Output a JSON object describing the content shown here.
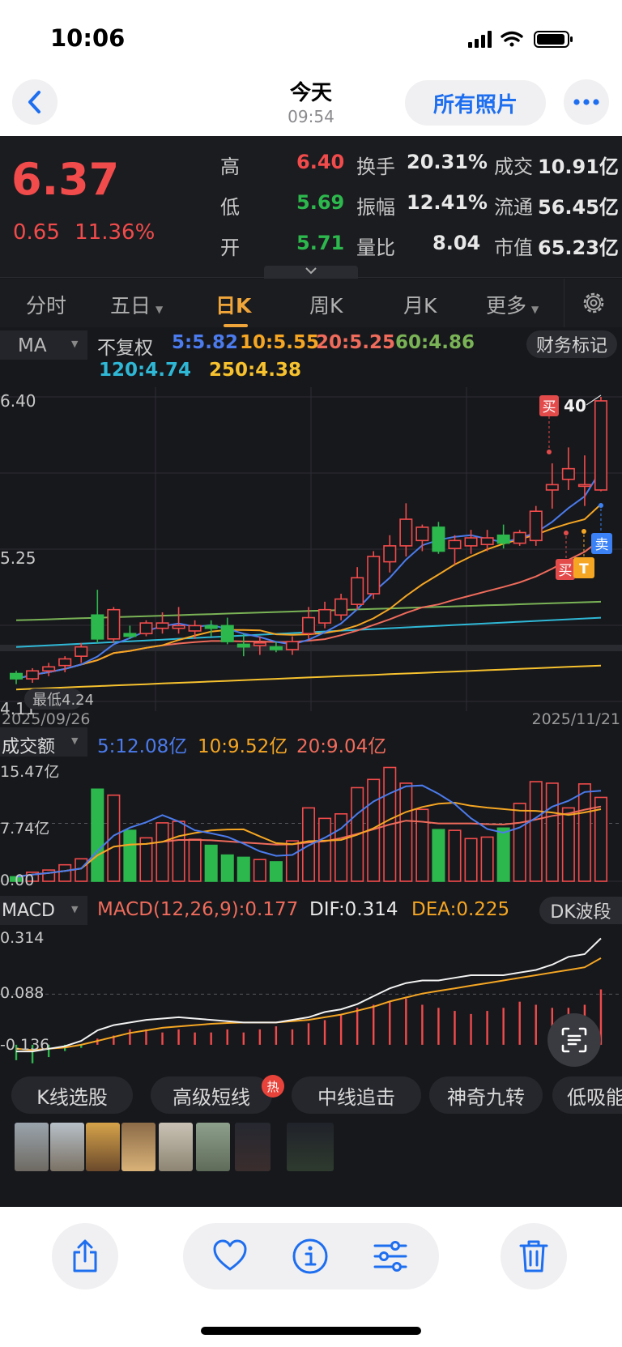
{
  "status_bar": {
    "time": "10:06"
  },
  "photos_nav": {
    "title": "今天",
    "subtitle": "09:54",
    "all_photos": "所有照片"
  },
  "quote": {
    "price": "6.37",
    "change": "0.65",
    "change_pct": "11.36%",
    "high_label": "高",
    "high": "6.40",
    "low_label": "低",
    "low": "5.69",
    "open_label": "开",
    "open": "5.71",
    "turnover_label": "换手",
    "turnover": "20.31%",
    "amplitude_label": "振幅",
    "amplitude": "12.41%",
    "volume_ratio_label": "量比",
    "volume_ratio": "8.04",
    "amount_label": "成交",
    "amount": "10.91亿",
    "float_label": "流通",
    "float_cap": "56.45亿",
    "mcap_label": "市值",
    "mcap": "65.23亿",
    "colors": {
      "up": "#f24b4b",
      "down": "#2db84d"
    }
  },
  "tabs": [
    {
      "label": "分时"
    },
    {
      "label": "五日"
    },
    {
      "label": "日K",
      "active": true
    },
    {
      "label": "周K"
    },
    {
      "label": "月K"
    },
    {
      "label": "更多"
    }
  ],
  "ma_legend": {
    "selector": "MA",
    "adjust": "不复权",
    "ma5": "5:5.82",
    "ma10": "10:5.55",
    "ma20": "20:5.25",
    "ma60": "60:4.86",
    "ma120": "120:4.74",
    "ma250": "250:4.38",
    "finance_marks": "财务标记",
    "colors": {
      "ma5": "#4b7bec",
      "ma10": "#f5a623",
      "ma20": "#ef6b5b",
      "ma60": "#7ab356",
      "ma120": "#2fb8d6",
      "ma250": "#f7c22e"
    }
  },
  "chart_data": [
    {
      "type": "candlestick",
      "y_ticks": [
        "6.40",
        "5.25",
        "4.11"
      ],
      "ylim": [
        4.11,
        6.4
      ],
      "x_start": "2025/09/26",
      "x_end": "2025/11/21",
      "low_marker": "最低4.24",
      "high_marker": "40",
      "buy_label": "买",
      "sell_label": "卖",
      "t_label": "T",
      "candles": [
        {
          "o": 4.32,
          "h": 4.34,
          "l": 4.24,
          "c": 4.28
        },
        {
          "o": 4.28,
          "h": 4.36,
          "l": 4.25,
          "c": 4.34
        },
        {
          "o": 4.34,
          "h": 4.4,
          "l": 4.3,
          "c": 4.37
        },
        {
          "o": 4.38,
          "h": 4.45,
          "l": 4.33,
          "c": 4.43
        },
        {
          "o": 4.45,
          "h": 4.55,
          "l": 4.4,
          "c": 4.52
        },
        {
          "o": 4.76,
          "h": 4.95,
          "l": 4.55,
          "c": 4.58
        },
        {
          "o": 4.58,
          "h": 4.82,
          "l": 4.55,
          "c": 4.8
        },
        {
          "o": 4.62,
          "h": 4.68,
          "l": 4.58,
          "c": 4.6
        },
        {
          "o": 4.62,
          "h": 4.72,
          "l": 4.6,
          "c": 4.7
        },
        {
          "o": 4.66,
          "h": 4.78,
          "l": 4.62,
          "c": 4.7
        },
        {
          "o": 4.66,
          "h": 4.82,
          "l": 4.62,
          "c": 4.68
        },
        {
          "o": 4.64,
          "h": 4.72,
          "l": 4.58,
          "c": 4.68
        },
        {
          "o": 4.68,
          "h": 4.72,
          "l": 4.6,
          "c": 4.66
        },
        {
          "o": 4.68,
          "h": 4.74,
          "l": 4.54,
          "c": 4.56
        },
        {
          "o": 4.54,
          "h": 4.62,
          "l": 4.45,
          "c": 4.52
        },
        {
          "o": 4.53,
          "h": 4.6,
          "l": 4.46,
          "c": 4.55
        },
        {
          "o": 4.52,
          "h": 4.56,
          "l": 4.48,
          "c": 4.5
        },
        {
          "o": 4.5,
          "h": 4.6,
          "l": 4.46,
          "c": 4.56
        },
        {
          "o": 4.62,
          "h": 4.82,
          "l": 4.58,
          "c": 4.74
        },
        {
          "o": 4.7,
          "h": 4.86,
          "l": 4.66,
          "c": 4.8
        },
        {
          "o": 4.76,
          "h": 4.92,
          "l": 4.72,
          "c": 4.88
        },
        {
          "o": 4.84,
          "h": 5.12,
          "l": 4.8,
          "c": 5.04
        },
        {
          "o": 4.92,
          "h": 5.24,
          "l": 4.88,
          "c": 5.2
        },
        {
          "o": 5.16,
          "h": 5.36,
          "l": 5.08,
          "c": 5.28
        },
        {
          "o": 5.28,
          "h": 5.6,
          "l": 5.2,
          "c": 5.48
        },
        {
          "o": 5.32,
          "h": 5.44,
          "l": 5.24,
          "c": 5.42
        },
        {
          "o": 5.42,
          "h": 5.46,
          "l": 5.22,
          "c": 5.24
        },
        {
          "o": 5.26,
          "h": 5.36,
          "l": 5.14,
          "c": 5.32
        },
        {
          "o": 5.28,
          "h": 5.4,
          "l": 5.22,
          "c": 5.34
        },
        {
          "o": 5.29,
          "h": 5.4,
          "l": 5.24,
          "c": 5.34
        },
        {
          "o": 5.36,
          "h": 5.44,
          "l": 5.26,
          "c": 5.3
        },
        {
          "o": 5.3,
          "h": 5.4,
          "l": 5.28,
          "c": 5.38
        },
        {
          "o": 5.32,
          "h": 5.58,
          "l": 5.28,
          "c": 5.54
        },
        {
          "o": 5.7,
          "h": 5.9,
          "l": 5.56,
          "c": 5.74
        },
        {
          "o": 5.78,
          "h": 6.02,
          "l": 5.7,
          "c": 5.86
        },
        {
          "o": 5.74,
          "h": 5.96,
          "l": 5.58,
          "c": 5.74
        },
        {
          "o": 5.7,
          "h": 6.4,
          "l": 5.69,
          "c": 6.37
        }
      ]
    },
    {
      "type": "bar",
      "title": "成交额",
      "y_ticks": [
        "15.47亿",
        "7.74亿",
        "0.00"
      ],
      "ylim": [
        0,
        15.47
      ],
      "ma5": "5:12.08亿",
      "ma10": "10:9.52亿",
      "ma20": "20:9.04亿",
      "values": [
        0.6,
        1.2,
        1.5,
        2.2,
        3.0,
        12.3,
        11.5,
        6.8,
        5.8,
        7.8,
        8.0,
        5.6,
        4.8,
        3.5,
        3.2,
        2.9,
        2.6,
        5.4,
        9.8,
        8.4,
        9.0,
        12.5,
        13.6,
        15.2,
        13.1,
        9.6,
        6.9,
        6.8,
        5.7,
        5.9,
        7.1,
        10.4,
        13.3,
        13.1,
        9.8,
        13.0,
        11.2
      ]
    },
    {
      "type": "bar",
      "title": "MACD",
      "params": "MACD(12,26,9):0.177",
      "dif": "DIF:0.314",
      "dea": "DEA:0.225",
      "y_ticks": [
        "0.314",
        "0.088",
        "-0.136"
      ],
      "ylim": [
        -0.136,
        0.314
      ],
      "hist": [
        -0.05,
        -0.06,
        -0.04,
        -0.02,
        -0.01,
        0.02,
        0.03,
        0.05,
        0.05,
        0.04,
        0.05,
        0.04,
        0.04,
        0.05,
        0.04,
        0.05,
        0.06,
        0.05,
        0.07,
        0.08,
        0.1,
        0.12,
        0.13,
        0.14,
        0.15,
        0.13,
        0.12,
        0.11,
        0.1,
        0.11,
        0.12,
        0.14,
        0.13,
        0.12,
        0.12,
        0.13,
        0.18
      ],
      "dif_values": [
        -0.13,
        -0.13,
        -0.12,
        -0.11,
        -0.09,
        -0.05,
        -0.03,
        -0.02,
        -0.01,
        -0.005,
        0.0,
        -0.005,
        -0.01,
        -0.015,
        -0.02,
        -0.02,
        -0.02,
        -0.01,
        0.0,
        0.02,
        0.03,
        0.05,
        0.08,
        0.11,
        0.13,
        0.14,
        0.14,
        0.15,
        0.16,
        0.16,
        0.16,
        0.17,
        0.18,
        0.2,
        0.23,
        0.24,
        0.3
      ],
      "dea_values": [
        -0.12,
        -0.125,
        -0.12,
        -0.115,
        -0.105,
        -0.09,
        -0.075,
        -0.06,
        -0.05,
        -0.04,
        -0.035,
        -0.03,
        -0.025,
        -0.022,
        -0.02,
        -0.02,
        -0.02,
        -0.015,
        -0.01,
        0.0,
        0.01,
        0.025,
        0.04,
        0.06,
        0.075,
        0.09,
        0.1,
        0.11,
        0.12,
        0.13,
        0.14,
        0.15,
        0.16,
        0.17,
        0.18,
        0.19,
        0.225
      ]
    }
  ],
  "volume_head": {
    "selector": "成交额"
  },
  "macd_head": {
    "selector": "MACD",
    "wave": "DK波段"
  },
  "strategy_chips": [
    "K线选股",
    "高级短线",
    "中线追击",
    "神奇九转",
    "低吸能"
  ],
  "hot_badge": "热"
}
